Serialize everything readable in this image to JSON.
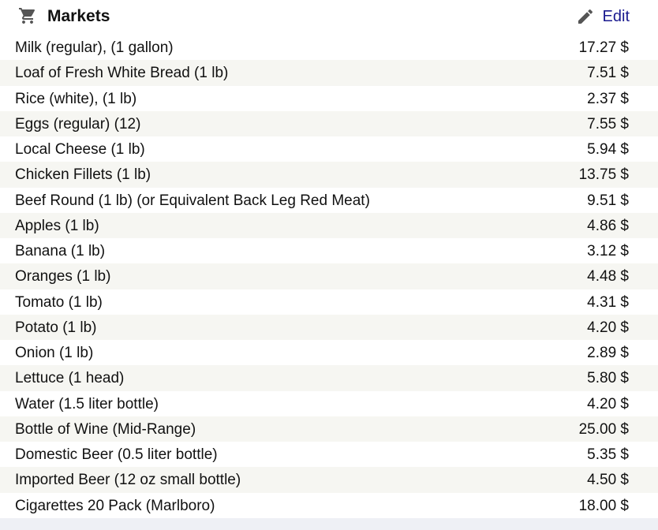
{
  "header": {
    "title": "Markets",
    "icon": "cart-icon",
    "edit_label": "Edit",
    "edit_icon": "pencil-icon",
    "link_color": "#1a1a8f"
  },
  "items": [
    {
      "name": "Milk (regular), (1 gallon)",
      "price": "17.27 $"
    },
    {
      "name": "Loaf of Fresh White Bread (1 lb)",
      "price": "7.51 $"
    },
    {
      "name": "Rice (white), (1 lb)",
      "price": "2.37 $"
    },
    {
      "name": "Eggs (regular) (12)",
      "price": "7.55 $"
    },
    {
      "name": "Local Cheese (1 lb)",
      "price": "5.94 $"
    },
    {
      "name": "Chicken Fillets (1 lb)",
      "price": "13.75 $"
    },
    {
      "name": "Beef Round (1 lb) (or Equivalent Back Leg Red Meat)",
      "price": "9.51 $"
    },
    {
      "name": "Apples (1 lb)",
      "price": "4.86 $"
    },
    {
      "name": "Banana (1 lb)",
      "price": "3.12 $"
    },
    {
      "name": "Oranges (1 lb)",
      "price": "4.48 $"
    },
    {
      "name": "Tomato (1 lb)",
      "price": "4.31 $"
    },
    {
      "name": "Potato (1 lb)",
      "price": "4.20 $"
    },
    {
      "name": "Onion (1 lb)",
      "price": "2.89 $"
    },
    {
      "name": "Lettuce (1 head)",
      "price": "5.80 $"
    },
    {
      "name": "Water (1.5 liter bottle)",
      "price": "4.20 $"
    },
    {
      "name": "Bottle of Wine (Mid-Range)",
      "price": "25.00 $"
    },
    {
      "name": "Domestic Beer (0.5 liter bottle)",
      "price": "5.35 $"
    },
    {
      "name": "Imported Beer (12 oz small bottle)",
      "price": "4.50 $"
    },
    {
      "name": "Cigarettes 20 Pack (Marlboro)",
      "price": "18.00 $"
    }
  ]
}
